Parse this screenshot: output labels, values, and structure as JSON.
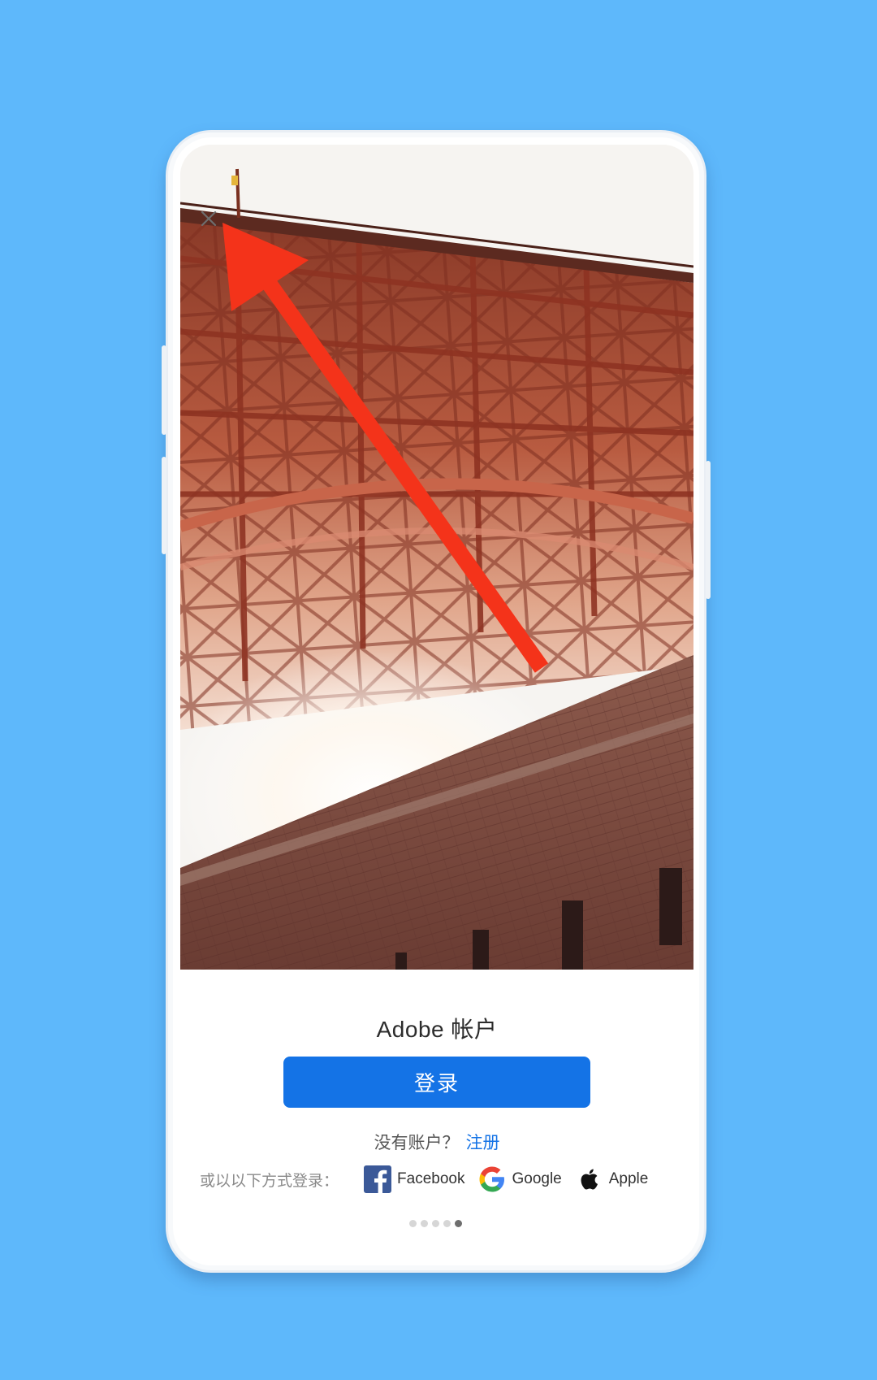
{
  "account": {
    "title": "Adobe 帐户",
    "login_label": "登录",
    "no_account_text": "没有账户？",
    "register_label": "注册",
    "social_prompt": "或以以下方式登录："
  },
  "social": {
    "facebook_label": "Facebook",
    "google_label": "Google",
    "apple_label": "Apple"
  },
  "carousel": {
    "total": 5,
    "active_index": 5
  },
  "icons": {
    "close": "close-icon",
    "facebook": "facebook-icon",
    "google": "google-icon",
    "apple": "apple-icon",
    "annotation": "arrow-annotation"
  },
  "colors": {
    "background": "#5eb8fb",
    "primary_button": "#1473e6",
    "link": "#1473e6",
    "annotation_arrow": "#f4331a"
  }
}
